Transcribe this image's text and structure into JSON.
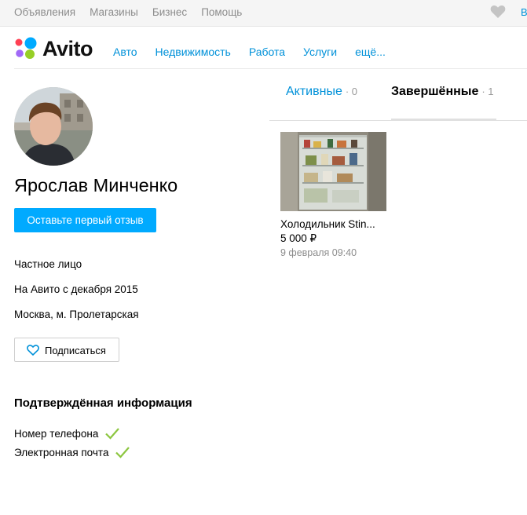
{
  "topbar": {
    "links": [
      "Объявления",
      "Магазины",
      "Бизнес",
      "Помощь"
    ],
    "right_link_fragment": "В",
    "favorites_icon": "heart-icon"
  },
  "header": {
    "logo_text": "Avito",
    "nav": [
      "Авто",
      "Недвижимость",
      "Работа",
      "Услуги",
      "ещё..."
    ]
  },
  "profile": {
    "name": "Ярослав Минченко",
    "review_button": "Оставьте первый отзыв",
    "seller_type": "Частное лицо",
    "since": "На Авито с декабря 2015",
    "location": "Москва, м. Пролетарская",
    "subscribe_button": "Подписаться"
  },
  "verified": {
    "title": "Подтверждённая информация",
    "items": [
      "Номер телефона",
      "Электронная почта"
    ]
  },
  "tabs": [
    {
      "label": "Активные",
      "count": "· 0",
      "active": false
    },
    {
      "label": "Завершённые",
      "count": "· 1",
      "active": true
    }
  ],
  "listing": {
    "title": "Холодильник Stin...",
    "price": "5 000 ₽",
    "date": "9 февраля 09:40"
  },
  "colors": {
    "link": "#0091d9",
    "primary_button": "#00aaff",
    "check": "#8cc63f",
    "logo_dots": [
      "#00aaff",
      "#ff4053",
      "#97cf26",
      "#a169f7"
    ]
  }
}
